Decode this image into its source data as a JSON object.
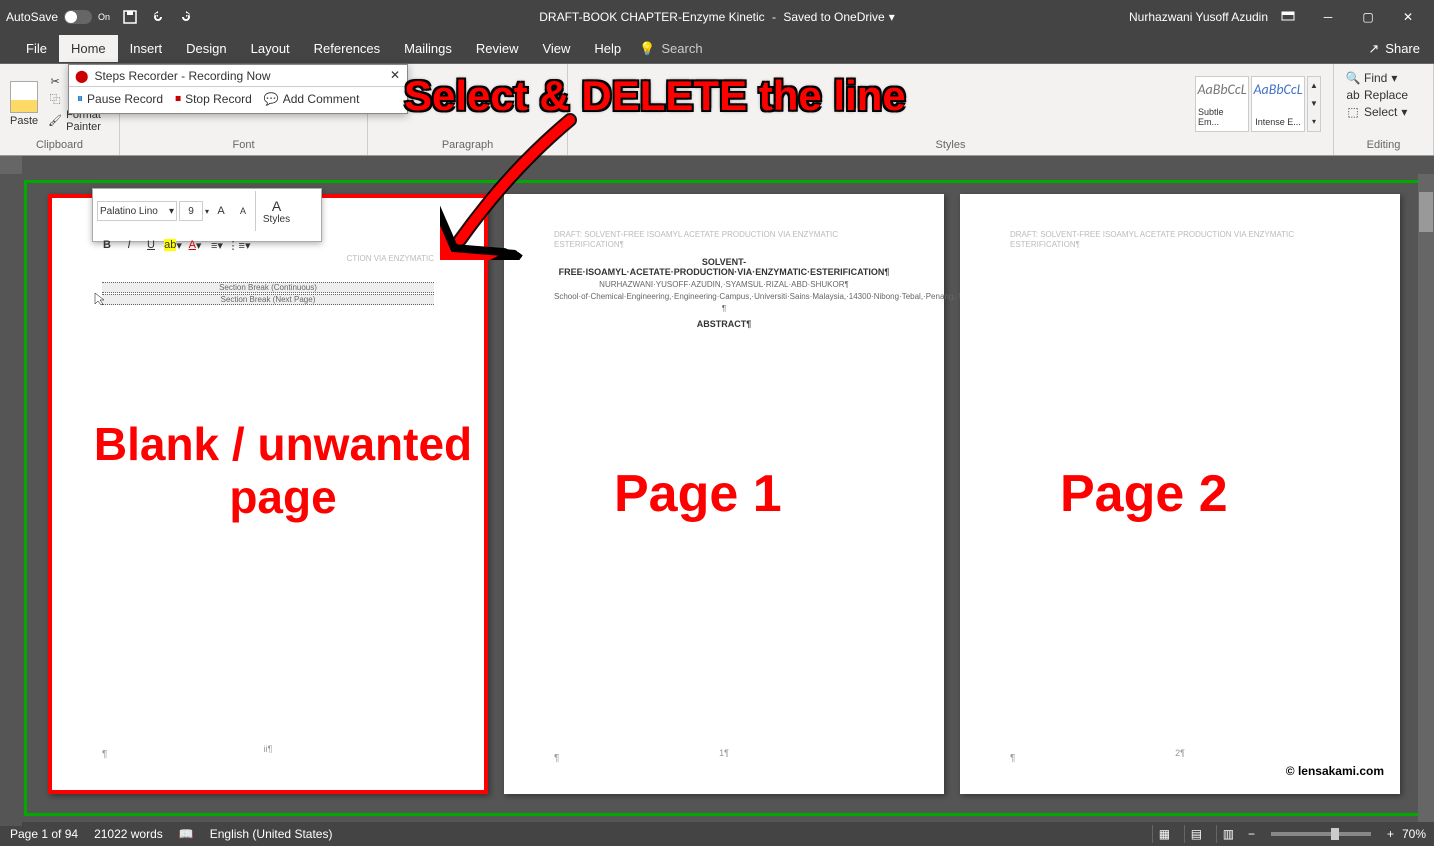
{
  "titlebar": {
    "autosave_label": "AutoSave",
    "autosave_state": "On",
    "doc_name": "DRAFT-BOOK CHAPTER-Enzyme Kinetic",
    "save_status": "Saved to OneDrive",
    "user_name": "Nurhazwani Yusoff Azudin"
  },
  "tabs": {
    "file": "File",
    "home": "Home",
    "insert": "Insert",
    "design": "Design",
    "layout": "Layout",
    "references": "References",
    "mailings": "Mailings",
    "review": "Review",
    "view": "View",
    "help": "Help",
    "search_placeholder": "Search"
  },
  "ribbon": {
    "clipboard": {
      "label": "Clipboard",
      "paste": "Paste",
      "cut": "Cut",
      "copy": "Copy",
      "format_painter": "Format Painter"
    },
    "font": {
      "label": "Font"
    },
    "paragraph": {
      "label": "Paragraph"
    },
    "styles": {
      "label": "Styles",
      "items": [
        {
          "preview": "AaBbCcL",
          "name": "Subtle Em..."
        },
        {
          "preview": "AaBbCcL",
          "name": "Intense E..."
        }
      ]
    },
    "editing": {
      "label": "Editing",
      "find": "Find",
      "replace": "Replace",
      "select": "Select"
    },
    "share": "Share"
  },
  "steps_recorder": {
    "title": "Steps Recorder - Recording Now",
    "pause": "Pause Record",
    "stop": "Stop Record",
    "comment": "Add Comment"
  },
  "mini_toolbar": {
    "font": "Palatino Lino",
    "size": "9",
    "styles": "Styles"
  },
  "document": {
    "header_text": "DRAFT: SOLVENT-FREE ISOAMYL ACETATE PRODUCTION VIA ENZYMATIC ESTERIFICATION¶",
    "header_partial": "CTION VIA ENZYMATIC",
    "title": "SOLVENT-FREE·ISOAMYL·ACETATE·PRODUCTION·VIA·ENZYMATIC·ESTERIFICATION¶",
    "authors": "NURHAZWANI·YUSOFF·AZUDIN,·SYAMSUL·RIZAL·ABD·SHUKOR¶",
    "affiliation": "School·of·Chemical·Engineering,·Engineering·Campus,·Universiti·Sains·Malaysia,·14300·Nibong·Tebal,·Penang,·Malaysia.¶",
    "abstract": "ABSTRACT¶",
    "para_mark": "¶",
    "section_break_cont": "Section Break (Continuous)",
    "section_break_next": "Section Break (Next Page)",
    "footer_ii": "ii¶",
    "footer_1": "1¶",
    "footer_2": "2¶"
  },
  "annotations": {
    "top": "Select & DELETE the line",
    "blank": "Blank / unwanted page",
    "page1": "Page 1",
    "page2": "Page 2",
    "watermark": "© lensakami.com"
  },
  "statusbar": {
    "page": "Page 1 of 94",
    "words": "21022 words",
    "language": "English (United States)",
    "zoom": "70%"
  }
}
